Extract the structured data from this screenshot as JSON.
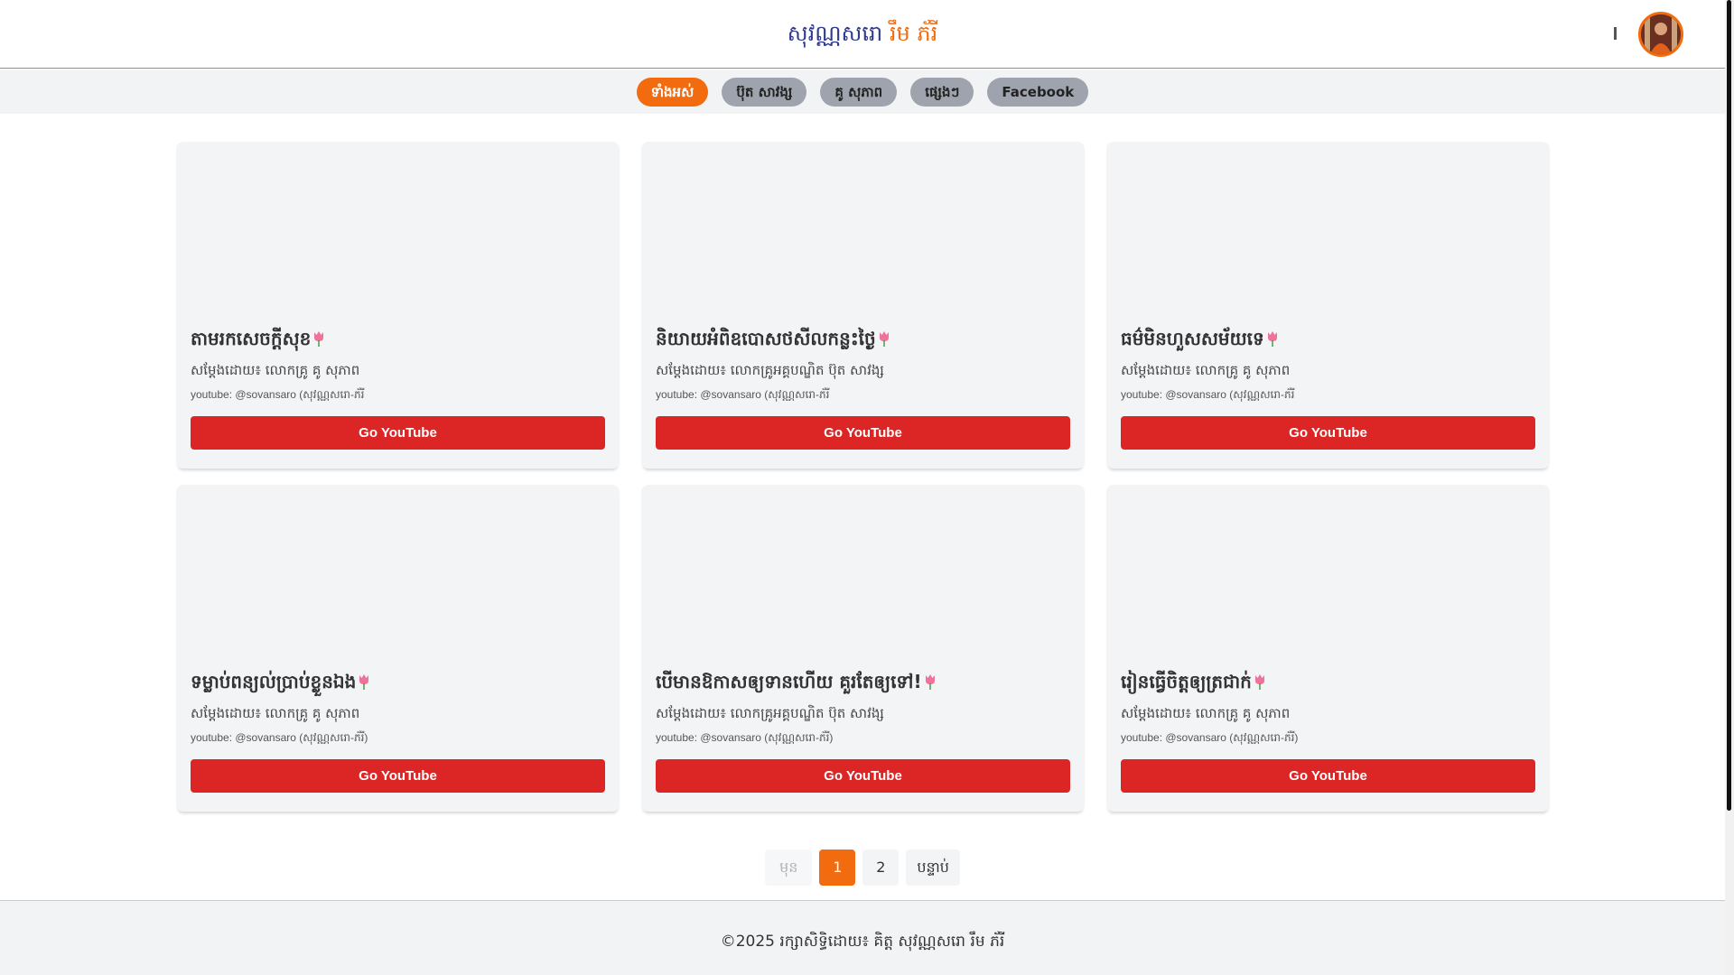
{
  "header": {
    "brand_part1": "សុវណ្ណសរោ",
    "brand_part2": "រឹម ភ័រី",
    "menu_icon": "menu-icon",
    "avatar_icon": "avatar-photo"
  },
  "filters": [
    {
      "label": "ទាំងអស់",
      "active": true
    },
    {
      "label": "ប៊ុត សាវង្ស",
      "active": false
    },
    {
      "label": "គូ សុភាព",
      "active": false
    },
    {
      "label": "ផ្សេងៗ",
      "active": false
    },
    {
      "label": "Facebook",
      "active": false
    }
  ],
  "cards": [
    {
      "title": "តាមរកសេចក្តីសុខ",
      "speaker": "សម្តែងដោយ៖ លោកគ្រូ គូ សុភាព",
      "channel": "youtube: @sovansaro (សុវណ្ណសរោ-ភ័រី",
      "button": "Go YouTube"
    },
    {
      "title": "និយាយអំពិឧបោសថសីលកន្លះថ្ងៃ",
      "speaker": "សម្តែងដោយ៖ លោកគ្រូអគ្គបណ្ឌិត ប៊ុត សាវង្ស",
      "channel": "youtube: @sovansaro (សុវណ្ណសរោ-ភ័រី",
      "button": "Go YouTube"
    },
    {
      "title": "ធម៌មិនហួសសម័យទេ",
      "speaker": "សម្តែងដោយ៖ លោកគ្រូ គូ សុភាព",
      "channel": "youtube: @sovansaro (សុវណ្ណសរោ-ភ័រី",
      "button": "Go YouTube"
    },
    {
      "title": "ទម្លាប់ពន្យល់ប្រាប់ខ្លួនឯង",
      "speaker": "សម្តែងដោយ៖ លោកគ្រូ គូ សុភាព",
      "channel": "youtube: @sovansaro (សុវណ្ណសរោ-ភ័រី)",
      "button": "Go YouTube"
    },
    {
      "title": "បើមានឱកាសឲ្យទានហើយ គួរតែឲ្យទៅ!",
      "speaker": "សម្តែងដោយ៖ លោកគ្រូអគ្គបណ្ឌិត ប៊ុត សាវង្ស",
      "channel": "youtube: @sovansaro (សុវណ្ណសរោ-ភ័រី)",
      "button": "Go YouTube"
    },
    {
      "title": "រៀនធ្វើចិត្តឲ្យត្រជាក់",
      "speaker": "សម្តែងដោយ៖ លោកគ្រូ គូ សុភាព",
      "channel": "youtube: @sovansaro (សុវណ្ណសរោ-ភ័រី)",
      "button": "Go YouTube"
    }
  ],
  "pagination": {
    "prev": "មុន",
    "pages": [
      "1",
      "2"
    ],
    "current": "1",
    "next": "បន្ទាប់"
  },
  "footer": {
    "text": "©2025 រក្សាសិទ្ធិដោយ៖ គិត្ត សុវណ្ណសរោ រឹម ភ័រី"
  },
  "colors": {
    "accent": "#f26b0f",
    "brand_blue": "#2f3a8f",
    "youtube_red": "#dc2626",
    "chip_gray": "#9ea3ad"
  }
}
